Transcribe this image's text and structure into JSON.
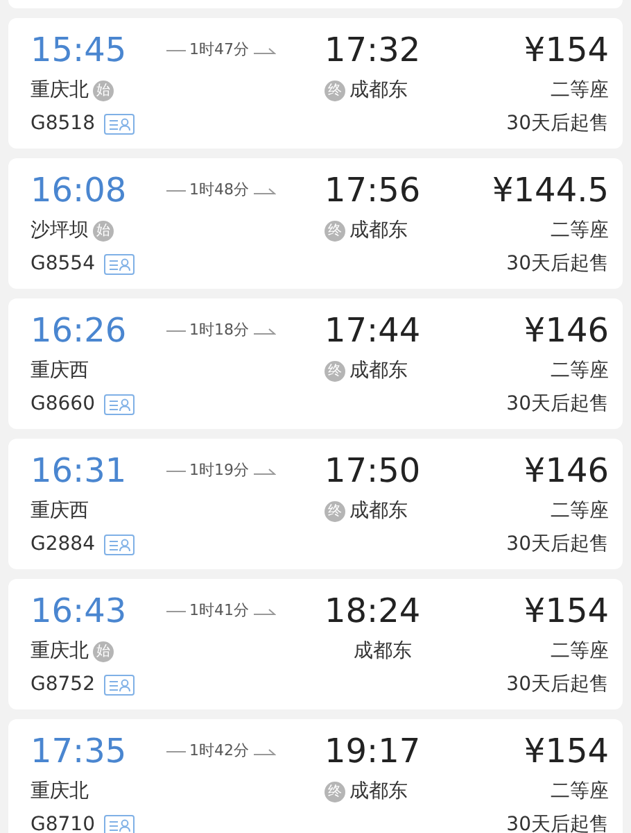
{
  "trains": [
    {
      "depart_time": "15:45",
      "duration": "1时47分",
      "arrive_time": "17:32",
      "price": "¥154",
      "from": "重庆北",
      "from_mark": "始",
      "to": "成都东",
      "to_mark": "终",
      "seat": "二等座",
      "number": "G8518",
      "sale": "30天后起售"
    },
    {
      "depart_time": "16:08",
      "duration": "1时48分",
      "arrive_time": "17:56",
      "price": "¥144.5",
      "from": "沙坪坝",
      "from_mark": "始",
      "to": "成都东",
      "to_mark": "终",
      "seat": "二等座",
      "number": "G8554",
      "sale": "30天后起售"
    },
    {
      "depart_time": "16:26",
      "duration": "1时18分",
      "arrive_time": "17:44",
      "price": "¥146",
      "from": "重庆西",
      "to": "成都东",
      "to_mark": "终",
      "seat": "二等座",
      "number": "G8660",
      "sale": "30天后起售"
    },
    {
      "depart_time": "16:31",
      "duration": "1时19分",
      "arrive_time": "17:50",
      "price": "¥146",
      "from": "重庆西",
      "to": "成都东",
      "to_mark": "终",
      "seat": "二等座",
      "number": "G2884",
      "sale": "30天后起售"
    },
    {
      "depart_time": "16:43",
      "duration": "1时41分",
      "arrive_time": "18:24",
      "price": "¥154",
      "from": "重庆北",
      "from_mark": "始",
      "to": "成都东",
      "seat": "二等座",
      "number": "G8752",
      "sale": "30天后起售"
    },
    {
      "depart_time": "17:35",
      "duration": "1时42分",
      "arrive_time": "19:17",
      "price": "¥154",
      "from": "重庆北",
      "to": "成都东",
      "to_mark": "终",
      "seat": "二等座",
      "number": "G8710",
      "sale": "30天后起售"
    }
  ]
}
